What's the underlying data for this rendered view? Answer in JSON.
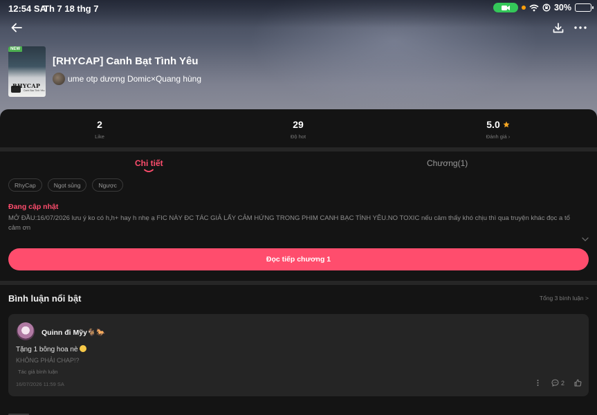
{
  "status_bar": {
    "time": "12:54 SA",
    "date": "Th 7 18 thg 7",
    "battery_text": "30%",
    "battery_level": 0.3,
    "camera_pill_color": "#34c759"
  },
  "topbar": {
    "back_icon": "arrow-left-icon",
    "download_icon": "download-icon",
    "more_icon": "more-horizontal-icon"
  },
  "book": {
    "badge": "NEW",
    "cover_title": "RHYCAP",
    "cover_subtitle": "Canh Bạc Tình Yêu",
    "title": "[RHYCAP] Canh Bạt Tình Yêu",
    "author": "ume otp dương Domic×Quang hùng"
  },
  "stats": [
    {
      "value": "2",
      "label": "Like"
    },
    {
      "value": "29",
      "label": "Độ hot"
    },
    {
      "value": "5.0",
      "label": "Đánh giá  ›"
    }
  ],
  "tabs": {
    "detail": "Chi tiết",
    "chapters": "Chương(1)"
  },
  "tags": [
    "RhyCap",
    "Ngọt sủng",
    "Ngược"
  ],
  "detail": {
    "status": "Đang cập nhật",
    "description": "MỞ ĐẦU:16/07/2026 lưu ý ko có h,h+ hay h nhẹ ạ FIC NÀY ĐC TÁC GIẢ LẤY CẢM HỨNG TRONG PHIM CANH BẠC TÌNH YÊU.NO TOXIC nếu cảm thấy khó chịu thì qua truyện khác đọc a tổ cảm ơn",
    "read_button": "Đọc tiếp chương 1"
  },
  "comments": {
    "title": "Bình luận nổi bật",
    "total": "Tổng 3 bình luận >",
    "items": [
      {
        "user": "Quinn đi Mỹy🐐🐎",
        "text": "Tặng 1 bông hoa nè",
        "reply": "KHÔNG PHẢI CHAP!?",
        "author_tag": "Tác giả bình luận",
        "date": "16/07/2026 11:59 SA",
        "reply_count": "2"
      }
    ]
  },
  "colors": {
    "accent": "#ff4d6d",
    "star": "#f5a623",
    "background": "#141414",
    "card": "#252525"
  }
}
